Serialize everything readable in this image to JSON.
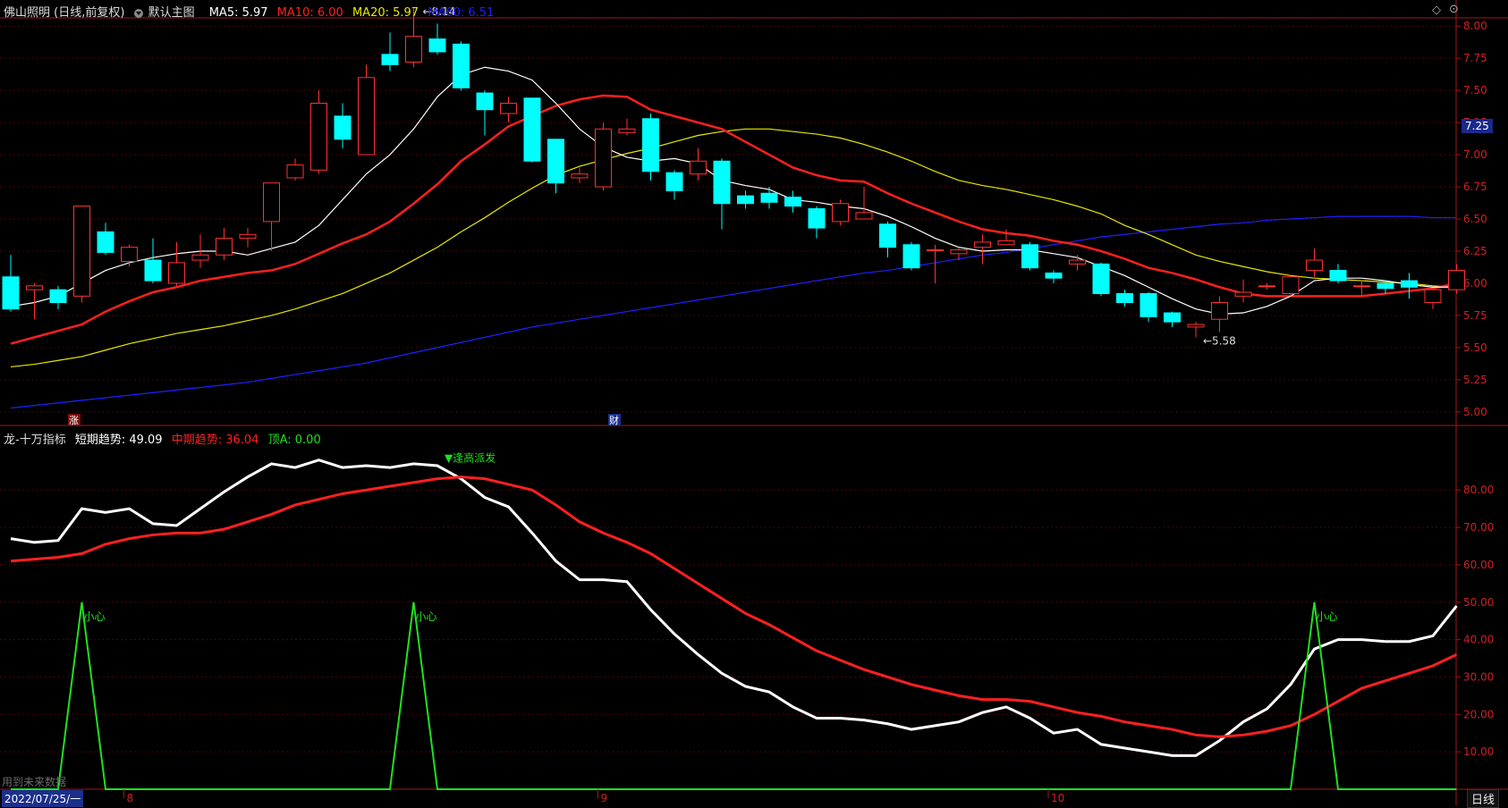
{
  "header": {
    "stock_title": "佛山照明 (日线,前复权)",
    "main_chart_label": "默认主图",
    "ma_labels": [
      {
        "text": "MA5: 5.97",
        "color": "#ffffff"
      },
      {
        "text": "MA10: 6.00",
        "color": "#ff2020"
      },
      {
        "text": "MA20: 5.97",
        "color": "#e8e800"
      },
      {
        "text": "MA60: 6.51",
        "color": "#2020ff"
      }
    ]
  },
  "indicator_header": {
    "name": "龙-十万指标",
    "labels": [
      {
        "text": "短期趋势: 49.09",
        "color": "#ffffff"
      },
      {
        "text": "中期趋势: 36.04",
        "color": "#ff2020"
      },
      {
        "text": "顶A: 0.00",
        "color": "#20e020"
      }
    ]
  },
  "price_tag": "7.25",
  "date_box": "2022/07/25/一",
  "period_button": "日线",
  "footer_note": "用到未来数据",
  "markers": {
    "zhang": "涨",
    "cai": "财"
  },
  "chart_data": [
    {
      "type": "candlestick",
      "ylim": [
        4.95,
        8.05
      ],
      "yticks": [
        "5.00",
        "5.25",
        "5.50",
        "5.75",
        "6.00",
        "6.25",
        "6.50",
        "6.75",
        "7.00",
        "7.25",
        "7.50",
        "7.75",
        "8.00"
      ],
      "xticks": [
        "8",
        "9",
        "10"
      ],
      "high_label": "8.14",
      "low_label": "5.58",
      "colors": {
        "up": "#ff3232",
        "down": "#00ffff",
        "ma5": "#ffffff",
        "ma10": "#ff2020",
        "ma20": "#e8e800",
        "ma60": "#2020ff"
      },
      "candles": [
        [
          6.05,
          5.8,
          6.22,
          5.78
        ],
        [
          5.95,
          5.98,
          6.0,
          5.72
        ],
        [
          5.95,
          5.85,
          5.98,
          5.8
        ],
        [
          5.9,
          6.6,
          6.6,
          5.85
        ],
        [
          6.4,
          6.24,
          6.47,
          6.22
        ],
        [
          6.17,
          6.28,
          6.3,
          6.13
        ],
        [
          6.18,
          6.02,
          6.35,
          6.0
        ],
        [
          6.0,
          6.16,
          6.32,
          5.98
        ],
        [
          6.18,
          6.22,
          6.38,
          6.12
        ],
        [
          6.22,
          6.35,
          6.43,
          6.18
        ],
        [
          6.35,
          6.38,
          6.43,
          6.28
        ],
        [
          6.48,
          6.78,
          6.78,
          6.25
        ],
        [
          6.82,
          6.92,
          6.97,
          6.8
        ],
        [
          6.88,
          7.4,
          7.5,
          6.85
        ],
        [
          7.3,
          7.12,
          7.4,
          7.05
        ],
        [
          7.0,
          7.6,
          7.7,
          7.0
        ],
        [
          7.78,
          7.7,
          7.95,
          7.65
        ],
        [
          7.72,
          7.92,
          8.14,
          7.68
        ],
        [
          7.9,
          7.8,
          8.02,
          7.78
        ],
        [
          7.86,
          7.52,
          7.88,
          7.5
        ],
        [
          7.48,
          7.35,
          7.5,
          7.15
        ],
        [
          7.32,
          7.4,
          7.45,
          7.25
        ],
        [
          7.44,
          6.95,
          7.44,
          6.94
        ],
        [
          7.12,
          6.78,
          7.12,
          6.7
        ],
        [
          6.82,
          6.85,
          6.9,
          6.78
        ],
        [
          6.75,
          7.2,
          7.25,
          6.72
        ],
        [
          7.17,
          7.2,
          7.28,
          7.15
        ],
        [
          7.28,
          6.87,
          7.32,
          6.8
        ],
        [
          6.86,
          6.72,
          6.88,
          6.65
        ],
        [
          6.85,
          6.95,
          7.05,
          6.8
        ],
        [
          6.95,
          6.62,
          6.97,
          6.42
        ],
        [
          6.68,
          6.62,
          6.72,
          6.58
        ],
        [
          6.7,
          6.63,
          6.75,
          6.58
        ],
        [
          6.67,
          6.6,
          6.72,
          6.55
        ],
        [
          6.58,
          6.43,
          6.6,
          6.35
        ],
        [
          6.48,
          6.62,
          6.65,
          6.45
        ],
        [
          6.5,
          6.55,
          6.75,
          6.5
        ],
        [
          6.46,
          6.28,
          6.48,
          6.2
        ],
        [
          6.3,
          6.12,
          6.32,
          6.1
        ],
        [
          6.26,
          6.26,
          6.3,
          6.0
        ],
        [
          6.23,
          6.26,
          6.28,
          6.18
        ],
        [
          6.28,
          6.32,
          6.38,
          6.15
        ],
        [
          6.3,
          6.33,
          6.42,
          6.3
        ],
        [
          6.3,
          6.12,
          6.32,
          6.1
        ],
        [
          6.08,
          6.04,
          6.1,
          6.0
        ],
        [
          6.15,
          6.18,
          6.22,
          6.1
        ],
        [
          6.15,
          5.92,
          6.16,
          5.9
        ],
        [
          5.92,
          5.85,
          5.95,
          5.82
        ],
        [
          5.92,
          5.74,
          5.93,
          5.7
        ],
        [
          5.77,
          5.7,
          5.78,
          5.66
        ],
        [
          5.66,
          5.68,
          5.7,
          5.58
        ],
        [
          5.72,
          5.85,
          5.9,
          5.62
        ],
        [
          5.9,
          5.93,
          6.03,
          5.85
        ],
        [
          5.98,
          5.98,
          6.0,
          5.95
        ],
        [
          5.92,
          6.05,
          6.05,
          5.9
        ],
        [
          6.1,
          6.18,
          6.27,
          6.05
        ],
        [
          6.1,
          6.02,
          6.15,
          6.0
        ],
        [
          5.98,
          5.98,
          6.02,
          5.9
        ],
        [
          6.0,
          5.96,
          6.02,
          5.92
        ],
        [
          6.02,
          5.97,
          6.08,
          5.88
        ],
        [
          5.85,
          5.95,
          5.95,
          5.8
        ],
        [
          5.95,
          6.1,
          6.15,
          5.92
        ]
      ],
      "ma5": [
        5.82,
        5.85,
        5.9,
        6.0,
        6.1,
        6.16,
        6.2,
        6.23,
        6.25,
        6.25,
        6.22,
        6.27,
        6.32,
        6.45,
        6.65,
        6.85,
        7.0,
        7.2,
        7.45,
        7.62,
        7.68,
        7.65,
        7.58,
        7.4,
        7.2,
        7.06,
        6.98,
        6.95,
        6.97,
        6.93,
        6.8,
        6.76,
        6.73,
        6.65,
        6.63,
        6.6,
        6.58,
        6.52,
        6.44,
        6.35,
        6.28,
        6.25,
        6.26,
        6.26,
        6.23,
        6.2,
        6.13,
        6.06,
        5.97,
        5.88,
        5.8,
        5.76,
        5.77,
        5.82,
        5.9,
        6.02,
        6.04,
        6.04,
        6.02,
        5.99,
        5.97,
        5.97
      ],
      "ma10": [
        5.53,
        5.58,
        5.63,
        5.68,
        5.78,
        5.86,
        5.93,
        5.97,
        6.02,
        6.05,
        6.08,
        6.1,
        6.15,
        6.23,
        6.31,
        6.38,
        6.48,
        6.62,
        6.77,
        6.95,
        7.08,
        7.22,
        7.3,
        7.38,
        7.43,
        7.46,
        7.45,
        7.35,
        7.3,
        7.25,
        7.2,
        7.1,
        7.0,
        6.9,
        6.84,
        6.8,
        6.79,
        6.7,
        6.62,
        6.55,
        6.48,
        6.42,
        6.39,
        6.37,
        6.33,
        6.3,
        6.25,
        6.19,
        6.12,
        6.08,
        6.03,
        5.97,
        5.92,
        5.9,
        5.9,
        5.9,
        5.9,
        5.9,
        5.92,
        5.94,
        5.96,
        6.0
      ],
      "ma20": [
        5.35,
        5.37,
        5.4,
        5.43,
        5.48,
        5.53,
        5.57,
        5.61,
        5.64,
        5.67,
        5.71,
        5.75,
        5.8,
        5.86,
        5.92,
        6.0,
        6.08,
        6.18,
        6.28,
        6.4,
        6.51,
        6.63,
        6.74,
        6.84,
        6.91,
        6.96,
        7.01,
        7.05,
        7.1,
        7.15,
        7.18,
        7.2,
        7.2,
        7.18,
        7.16,
        7.13,
        7.08,
        7.02,
        6.95,
        6.87,
        6.8,
        6.76,
        6.73,
        6.69,
        6.65,
        6.6,
        6.54,
        6.45,
        6.38,
        6.3,
        6.22,
        6.17,
        6.13,
        6.09,
        6.06,
        6.04,
        6.03,
        6.02,
        6.01,
        6.0,
        5.98,
        5.97
      ],
      "ma60": [
        5.03,
        5.05,
        5.07,
        5.09,
        5.11,
        5.13,
        5.15,
        5.17,
        5.19,
        5.21,
        5.23,
        5.26,
        5.29,
        5.32,
        5.35,
        5.38,
        5.42,
        5.46,
        5.5,
        5.54,
        5.58,
        5.62,
        5.66,
        5.69,
        5.72,
        5.75,
        5.78,
        5.81,
        5.84,
        5.87,
        5.9,
        5.93,
        5.96,
        5.99,
        6.02,
        6.05,
        6.08,
        6.1,
        6.13,
        6.16,
        6.19,
        6.22,
        6.24,
        6.27,
        6.3,
        6.33,
        6.36,
        6.38,
        6.4,
        6.42,
        6.44,
        6.46,
        6.47,
        6.49,
        6.5,
        6.51,
        6.52,
        6.52,
        6.52,
        6.52,
        6.51,
        6.51
      ]
    },
    {
      "type": "line",
      "title": "龙-十万指标",
      "ylim": [
        0,
        92
      ],
      "yticks": [
        "10.00",
        "20.00",
        "30.00",
        "40.00",
        "50.00",
        "60.00",
        "70.00",
        "80.00"
      ],
      "annotation": "▼逢高派发",
      "peak_label": "小心",
      "series": [
        {
          "name": "短期趋势",
          "color": "#ffffff",
          "values": [
            67,
            66,
            66.5,
            75,
            74,
            75,
            71,
            70.5,
            75,
            79.5,
            83.5,
            87,
            86,
            88,
            86,
            86.5,
            86,
            87,
            86.5,
            83,
            78,
            75.5,
            68.5,
            61,
            56,
            56,
            55.5,
            48,
            41.5,
            36,
            31,
            27.5,
            26,
            22,
            19,
            19,
            18.5,
            17.5,
            16,
            17,
            18,
            20.5,
            22,
            19,
            15,
            16,
            12,
            11,
            10,
            9,
            9,
            13,
            18,
            21.5,
            28,
            37.5,
            40,
            40,
            39.5,
            39.5,
            41,
            49
          ]
        },
        {
          "name": "中期趋势",
          "color": "#ff2020",
          "values": [
            61,
            61.5,
            62,
            63,
            65.5,
            67,
            68,
            68.5,
            68.5,
            69.5,
            71.5,
            73.5,
            76,
            77.5,
            79,
            80,
            81,
            82,
            83,
            83.5,
            83,
            81.5,
            80,
            76,
            71.5,
            68.5,
            66,
            63,
            59,
            55,
            51,
            47,
            44,
            40.5,
            37,
            34.5,
            32,
            30,
            28,
            26.5,
            25,
            24,
            24,
            23.5,
            22,
            20.5,
            19.5,
            18,
            17,
            16,
            14.5,
            14,
            14.5,
            15.5,
            17,
            20,
            23.5,
            27,
            29,
            31,
            33,
            36
          ]
        },
        {
          "name": "顶A",
          "color": "#20e020",
          "values": [
            0,
            0,
            0,
            50,
            0,
            0,
            0,
            0,
            0,
            0,
            0,
            0,
            0,
            0,
            0,
            0,
            0,
            50,
            0,
            0,
            0,
            0,
            0,
            0,
            0,
            0,
            0,
            0,
            0,
            0,
            0,
            0,
            0,
            0,
            0,
            0,
            0,
            0,
            0,
            0,
            0,
            0,
            0,
            0,
            0,
            0,
            0,
            0,
            0,
            0,
            0,
            0,
            0,
            0,
            0,
            50,
            0,
            0,
            0,
            0,
            0,
            0
          ]
        }
      ],
      "xticks": [
        "8",
        "9",
        "10"
      ]
    }
  ]
}
